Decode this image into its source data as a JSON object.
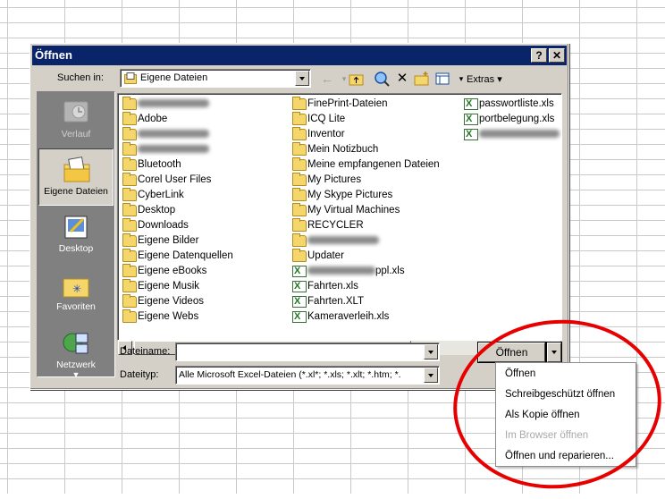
{
  "dialog": {
    "title": "Öffnen",
    "help_btn": "?",
    "close_btn": "✕"
  },
  "lookin": {
    "label": "Suchen in:",
    "value": "Eigene Dateien"
  },
  "toolbar": {
    "back_icon": "back-arrow-icon",
    "up_icon": "up-folder-icon",
    "extras_label": "Extras"
  },
  "places": [
    {
      "label": "Verlauf",
      "icon": "history-icon"
    },
    {
      "label": "Eigene Dateien",
      "icon": "my-documents-icon"
    },
    {
      "label": "Desktop",
      "icon": "desktop-icon"
    },
    {
      "label": "Favoriten",
      "icon": "favorites-icon"
    },
    {
      "label": "Netzwerk",
      "icon": "network-icon"
    }
  ],
  "files": {
    "col1": [
      {
        "name": "",
        "type": "folder"
      },
      {
        "name": "Adobe",
        "type": "folder"
      },
      {
        "name": "",
        "type": "folder"
      },
      {
        "name": "",
        "type": "folder"
      },
      {
        "name": "Bluetooth",
        "type": "folder"
      },
      {
        "name": "Corel User Files",
        "type": "folder"
      },
      {
        "name": "CyberLink",
        "type": "folder"
      },
      {
        "name": "Desktop",
        "type": "folder"
      },
      {
        "name": "Downloads",
        "type": "folder"
      },
      {
        "name": "Eigene Bilder",
        "type": "folder"
      },
      {
        "name": "Eigene Datenquellen",
        "type": "folder"
      },
      {
        "name": "Eigene eBooks",
        "type": "folder"
      },
      {
        "name": "Eigene Musik",
        "type": "folder"
      },
      {
        "name": "Eigene Videos",
        "type": "folder"
      },
      {
        "name": "Eigene Webs",
        "type": "folder"
      }
    ],
    "col2": [
      {
        "name": "FinePrint-Dateien",
        "type": "folder"
      },
      {
        "name": "ICQ Lite",
        "type": "folder"
      },
      {
        "name": "Inventor",
        "type": "folder"
      },
      {
        "name": "Mein Notizbuch",
        "type": "folder"
      },
      {
        "name": "Meine empfangenen Dateien",
        "type": "folder"
      },
      {
        "name": "My Pictures",
        "type": "folder"
      },
      {
        "name": "My Skype Pictures",
        "type": "folder"
      },
      {
        "name": "My Virtual Machines",
        "type": "folder"
      },
      {
        "name": "RECYCLER",
        "type": "folder"
      },
      {
        "name": "",
        "type": "folder"
      },
      {
        "name": "Updater",
        "type": "folder"
      },
      {
        "name": "ppl.xls",
        "type": "xls"
      },
      {
        "name": "Fahrten.xls",
        "type": "xls"
      },
      {
        "name": "Fahrten.XLT",
        "type": "xls"
      },
      {
        "name": "Kameraverleih.xls",
        "type": "xls"
      }
    ],
    "col3": [
      {
        "name": "passwortliste.xls",
        "type": "xls"
      },
      {
        "name": "portbelegung.xls",
        "type": "xls"
      },
      {
        "name": "",
        "type": "file"
      }
    ]
  },
  "filename": {
    "label": "Dateiname:",
    "value": ""
  },
  "filetype": {
    "label": "Dateityp:",
    "value": "Alle Microsoft Excel-Dateien (*.xl*; *.xls; *.xlt; *.htm; *."
  },
  "open_button": "Öffnen",
  "open_menu": [
    {
      "label": "Öffnen",
      "enabled": true
    },
    {
      "label": "Schreibgeschützt öffnen",
      "enabled": true
    },
    {
      "label": "Als Kopie öffnen",
      "enabled": true
    },
    {
      "label": "Im Browser öffnen",
      "enabled": false
    },
    {
      "label": "Öffnen und reparieren...",
      "enabled": true
    }
  ],
  "colors": {
    "title_bar": "#0a246a",
    "dialog_face": "#d4d0c8",
    "annotation_circle": "#e60000"
  }
}
